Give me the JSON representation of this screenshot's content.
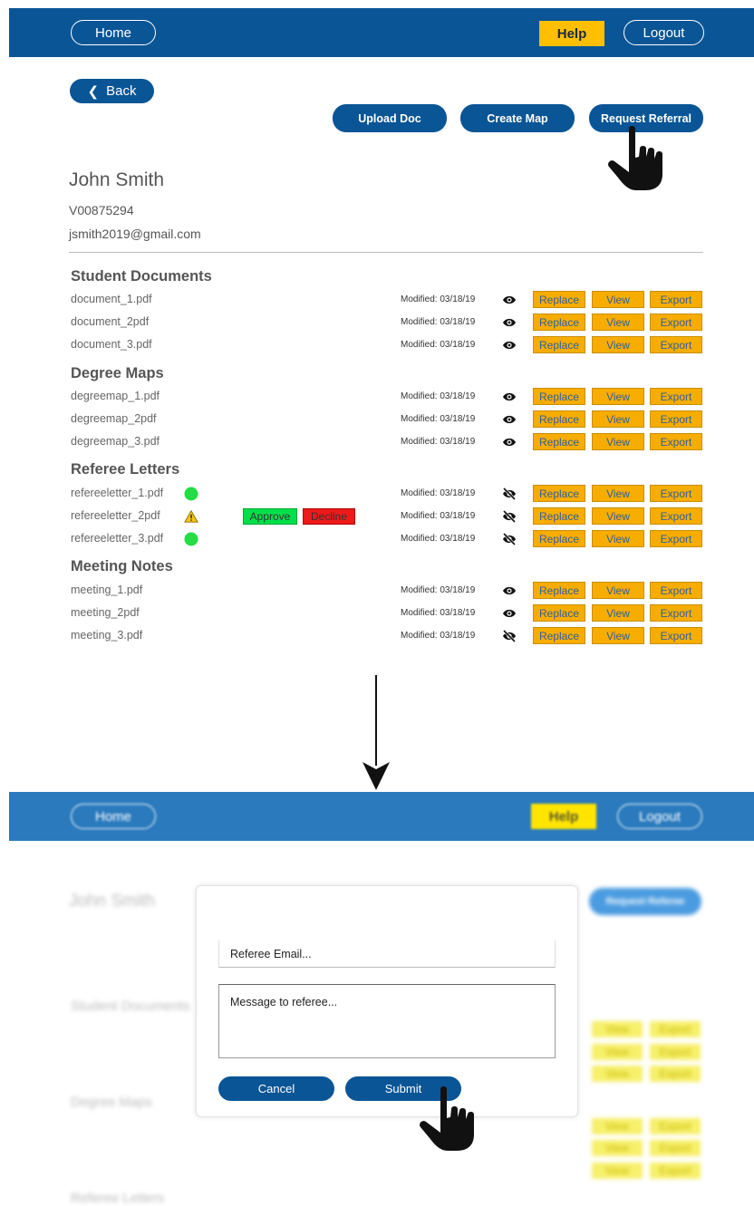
{
  "nav": {
    "home": "Home",
    "help": "Help",
    "logout": "Logout"
  },
  "actions": {
    "back": "Back",
    "upload_doc": "Upload Doc",
    "create_map": "Create Map",
    "request_referral": "Request Referral"
  },
  "student": {
    "name": "John Smith",
    "id": "V00875294",
    "email": "jsmith2019@gmail.com"
  },
  "row_buttons": {
    "replace": "Replace",
    "view": "View",
    "export": "Export"
  },
  "sections": [
    {
      "title": "Student Documents",
      "rows": [
        {
          "file": "document_1.pdf",
          "modified": "Modified: 03/18/19",
          "visibility": "eye-icon"
        },
        {
          "file": "document_2pdf",
          "modified": "Modified: 03/18/19",
          "visibility": "eye-icon"
        },
        {
          "file": "document_3.pdf",
          "modified": "Modified: 03/18/19",
          "visibility": "eye-icon"
        }
      ]
    },
    {
      "title": "Degree Maps",
      "rows": [
        {
          "file": "degreemap_1.pdf",
          "modified": "Modified: 03/18/19",
          "visibility": "eye-icon"
        },
        {
          "file": "degreemap_2pdf",
          "modified": "Modified: 03/18/19",
          "visibility": "eye-icon"
        },
        {
          "file": "degreemap_3.pdf",
          "modified": "Modified: 03/18/19",
          "visibility": "eye-icon"
        }
      ]
    },
    {
      "title": "Referee Letters",
      "rows": [
        {
          "file": "refereeletter_1.pdf",
          "modified": "Modified: 03/18/19",
          "visibility": "eye-slash-icon",
          "status": "approved-icon"
        },
        {
          "file": "refereeletter_2pdf",
          "modified": "Modified: 03/18/19",
          "visibility": "eye-slash-icon",
          "status": "warning-icon",
          "approve": "Approve",
          "decline": "Decline"
        },
        {
          "file": "refereeletter_3.pdf",
          "modified": "Modified: 03/18/19",
          "visibility": "eye-slash-icon",
          "status": "approved-icon"
        }
      ]
    },
    {
      "title": "Meeting Notes",
      "rows": [
        {
          "file": "meeting_1.pdf",
          "modified": "Modified: 03/18/19",
          "visibility": "eye-icon"
        },
        {
          "file": "meeting_2pdf",
          "modified": "Modified: 03/18/19",
          "visibility": "eye-icon"
        },
        {
          "file": "meeting_3.pdf",
          "modified": "Modified: 03/18/19",
          "visibility": "eye-slash-icon"
        }
      ]
    }
  ],
  "background": {
    "request_referee": "Request Referee",
    "student_name": "John Smith",
    "student_documents": "Student Documents",
    "degree_maps": "Degree Maps",
    "referee_letters": "Referee Letters",
    "view": "View",
    "export": "Export"
  },
  "modal": {
    "email_placeholder": "Referee Email...",
    "message_placeholder": "Message to referee...",
    "cancel": "Cancel",
    "submit": "Submit"
  },
  "colors": {
    "navy": "#0a5595",
    "blue_light": "#2a7abd",
    "orange": "#f7ad00",
    "help_yellow": "#ffbf00",
    "green": "#00e04a",
    "red": "#ee1a1a"
  }
}
